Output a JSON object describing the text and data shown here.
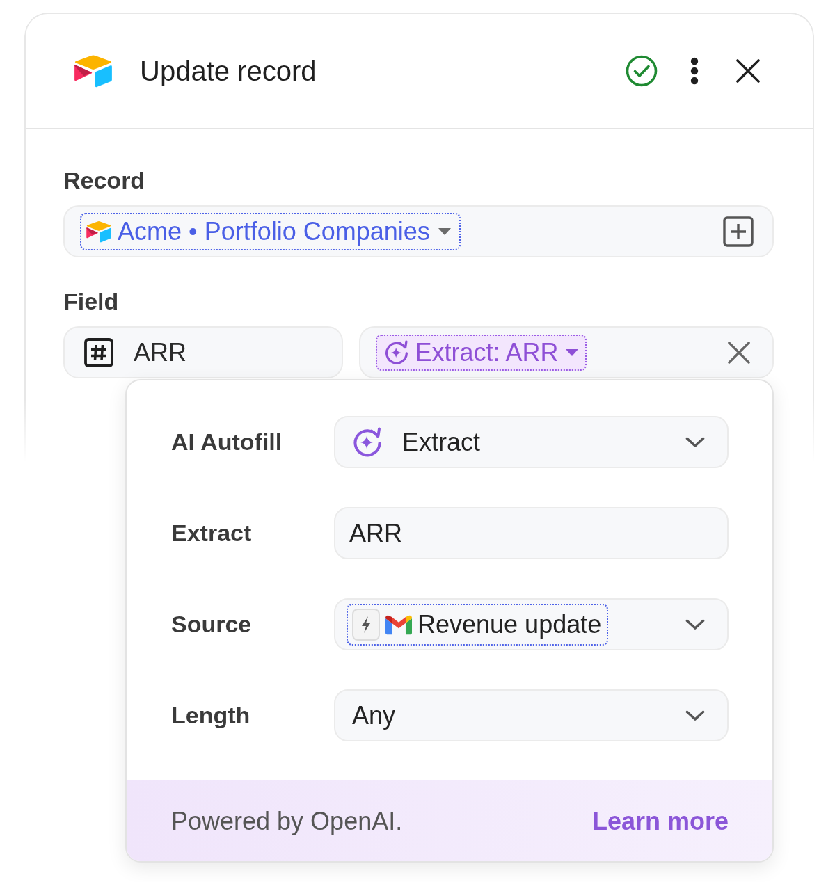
{
  "header": {
    "title": "Update record"
  },
  "record": {
    "label": "Record",
    "value": "Acme • Portfolio Companies"
  },
  "field": {
    "label": "Field",
    "name": "ARR",
    "autofill": "Extract: ARR"
  },
  "autofill_menu": {
    "rows": [
      {
        "kind": "autofill",
        "label": "AI Autofill",
        "value": "Extract"
      },
      {
        "kind": "text",
        "label": "Extract",
        "value": "ARR"
      },
      {
        "kind": "source",
        "label": "Source",
        "value": "Revenue update"
      },
      {
        "kind": "select",
        "label": "Length",
        "value": "Any"
      }
    ],
    "footer": {
      "text": "Powered by OpenAI.",
      "link": "Learn more"
    }
  }
}
